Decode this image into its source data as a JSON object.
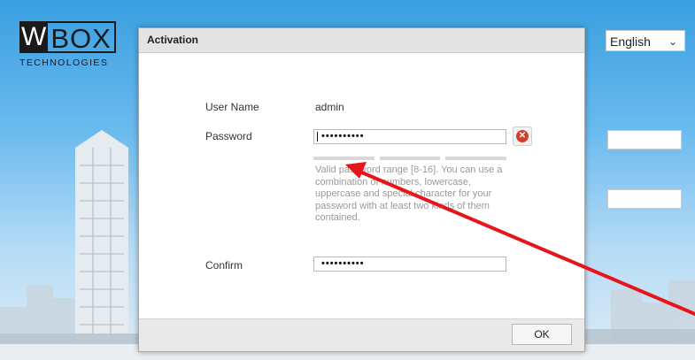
{
  "logo": {
    "letter_w": "W",
    "letters_box": "BOX",
    "subtitle": "TECHNOLOGIES"
  },
  "language": {
    "selected": "English",
    "chevron_icon": "chevron-down-icon"
  },
  "dialog": {
    "title": "Activation",
    "username_label": "User Name",
    "username_value": "admin",
    "password_label": "Password",
    "password_value": "••••••••••",
    "confirm_label": "Confirm",
    "confirm_value": "••••••••••",
    "clear_icon": "close-icon",
    "hint_lines": [
      "Valid password range [8-16]. You can use a",
      "combination of numbers, lowercase,",
      "uppercase and special character for your",
      "password with at least two kinds of them",
      "contained."
    ],
    "ok_label": "OK"
  },
  "annotation": {
    "arrow_color": "#e8141a"
  }
}
